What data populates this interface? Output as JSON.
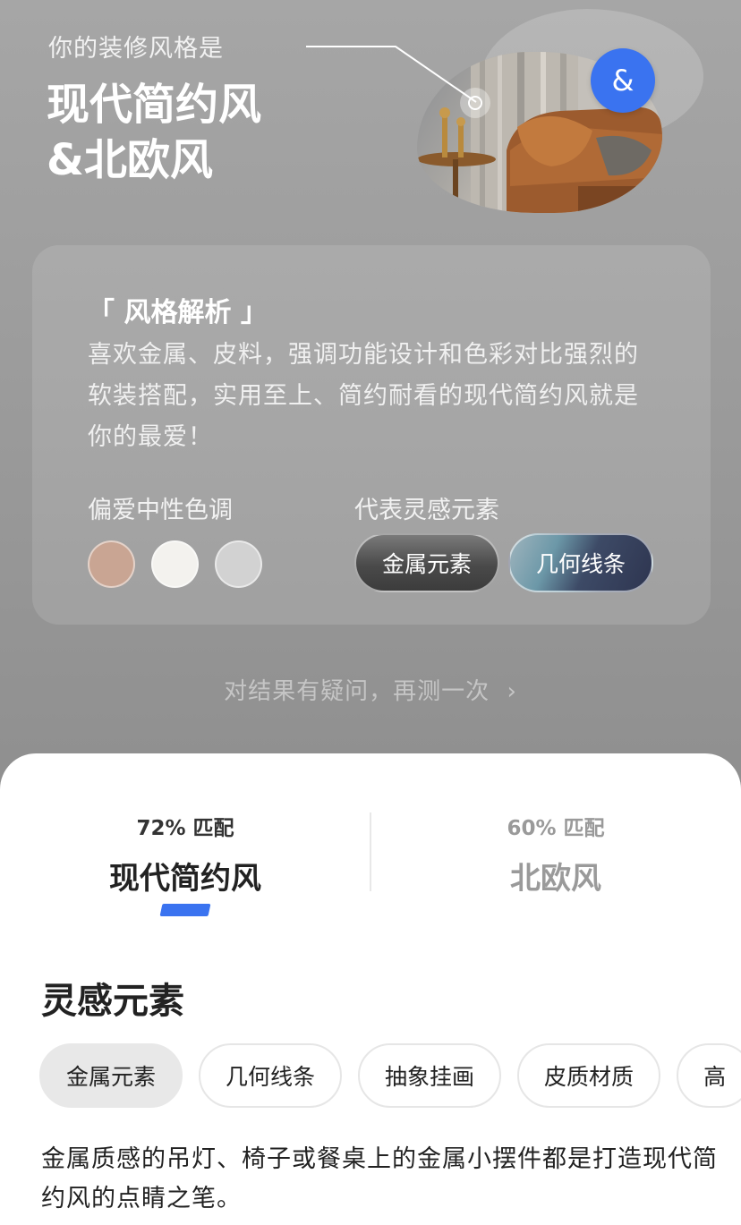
{
  "hero": {
    "subtitle": "你的装修风格是",
    "title_line1": "现代简约风",
    "title_line2": "&北欧风",
    "badge_symbol": "&"
  },
  "analysis": {
    "heading": "「 风格解析 」",
    "description": "喜欢金属、皮料，强调功能设计和色彩对比强烈的软装搭配，实用至上、简约耐看的现代简约风就是你的最爱！",
    "color_label": "偏爱中性色调",
    "swatches": [
      "#c9a593",
      "#f3f2ee",
      "#d2d2d2"
    ],
    "elements_label": "代表灵感元素",
    "elements": [
      "金属元素",
      "几何线条"
    ]
  },
  "retest": {
    "text": "对结果有疑问，再测一次",
    "arrow": "›"
  },
  "matches": [
    {
      "pct": "72% 匹配",
      "name": "现代简约风"
    },
    {
      "pct": "60% 匹配",
      "name": "北欧风"
    }
  ],
  "inspiration": {
    "title": "灵感元素",
    "chips": [
      "金属元素",
      "几何线条",
      "抽象挂画",
      "皮质材质",
      "高"
    ],
    "description": "金属质感的吊灯、椅子或餐桌上的金属小摆件都是打造现代简约风的点睛之笔。"
  },
  "colors": {
    "accent": "#3a73f0",
    "sheet_background": "#ffffff"
  }
}
